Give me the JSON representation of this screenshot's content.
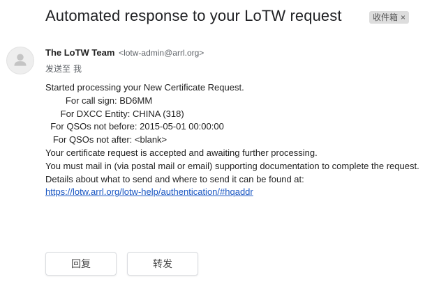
{
  "email": {
    "subject": "Automated response to your LoTW request",
    "label": "收件箱",
    "label_close": "×",
    "sender_name": "The LoTW Team",
    "sender_email": "<lotw-admin@arrl.org>",
    "to_prefix": "发送至",
    "to_name": "我",
    "body_lines": [
      "Started processing your New Certificate Request.",
      "        For call sign: BD6MM",
      "      For DXCC Entity: CHINA (318)",
      "  For QSOs not before: 2015-05-01 00:00:00",
      "   For QSOs not after: <blank>",
      "Your certificate request is accepted and awaiting further processing.",
      "You must mail in (via postal mail or email) supporting documentation to complete the request.",
      "Details about what to send and where to send it can be found at:"
    ],
    "link": "https://lotw.arrl.org/lotw-help/authentication/#hqaddr"
  },
  "actions": {
    "reply": "回复",
    "forward": "转发"
  },
  "icons": {
    "avatar": "person-icon"
  }
}
